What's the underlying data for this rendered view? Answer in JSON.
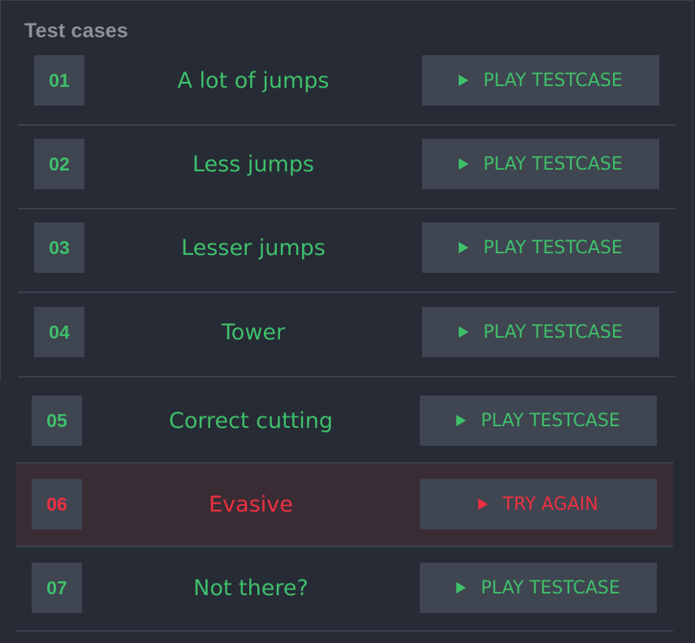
{
  "panel": {
    "title": "Test cases"
  },
  "colors": {
    "background": "#262b36",
    "tile": "#3f4551",
    "pass": "#3fbf6a",
    "fail": "#ee3040",
    "fail_row_bg": "#3a2c35"
  },
  "testcases": [
    {
      "num": "01",
      "name": "A lot of jumps",
      "button": "PLAY TESTCASE",
      "status": "pass"
    },
    {
      "num": "02",
      "name": "Less jumps",
      "button": "PLAY TESTCASE",
      "status": "pass"
    },
    {
      "num": "03",
      "name": "Lesser jumps",
      "button": "PLAY TESTCASE",
      "status": "pass"
    },
    {
      "num": "04",
      "name": "Tower",
      "button": "PLAY TESTCASE",
      "status": "pass"
    },
    {
      "num": "05",
      "name": "Correct cutting",
      "button": "PLAY TESTCASE",
      "status": "pass"
    },
    {
      "num": "06",
      "name": "Evasive",
      "button": "TRY AGAIN",
      "status": "fail"
    },
    {
      "num": "07",
      "name": "Not there?",
      "button": "PLAY TESTCASE",
      "status": "pass"
    }
  ],
  "icons": {
    "button_icon": "play-icon"
  }
}
